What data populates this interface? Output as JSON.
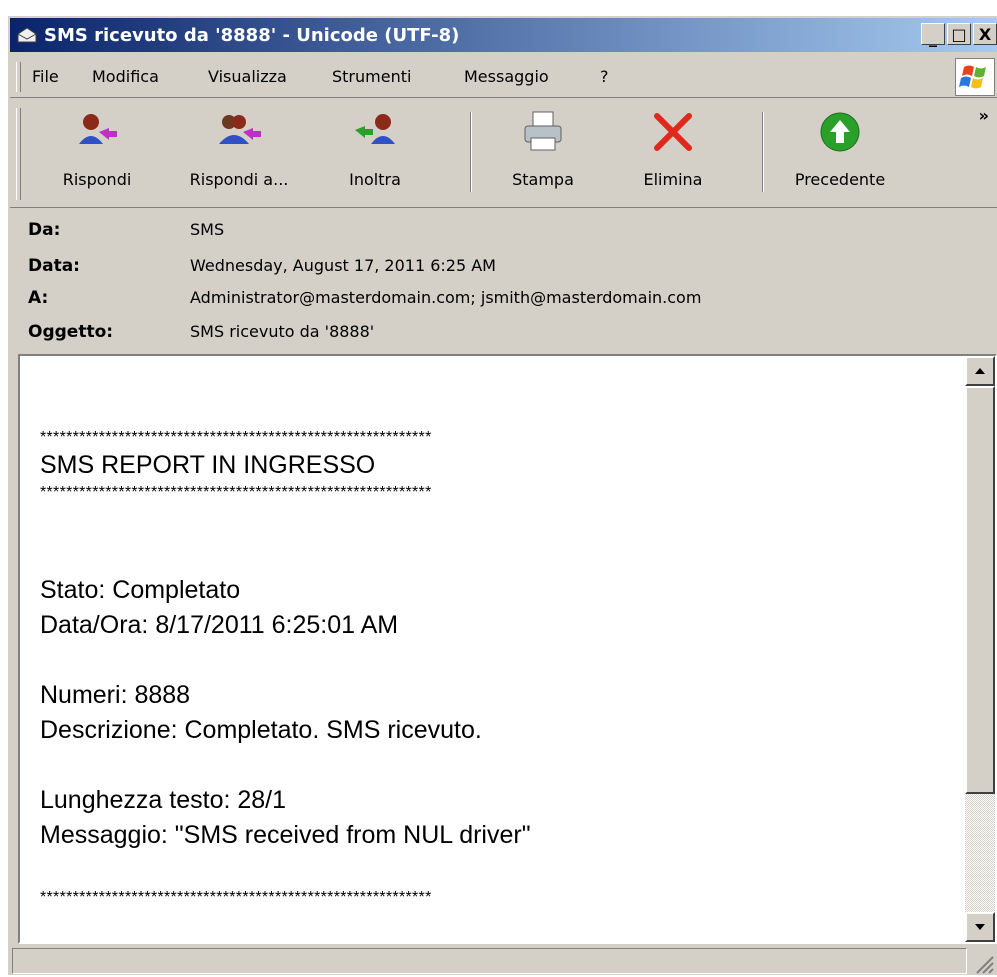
{
  "window": {
    "title": "SMS ricevuto da '8888' - Unicode (UTF-8)",
    "buttons": {
      "minimize": "_",
      "maximize": "□",
      "close": "X"
    }
  },
  "menu": {
    "items": [
      {
        "label": "File",
        "key": "F"
      },
      {
        "label": "Modifica",
        "key": "M"
      },
      {
        "label": "Visualizza",
        "key": "V"
      },
      {
        "label": "Strumenti",
        "key": "S"
      },
      {
        "label": "Messaggio",
        "key": "e"
      },
      {
        "label": "?",
        "key": "?"
      }
    ]
  },
  "toolbar": {
    "reply": "Rispondi",
    "reply_all": "Rispondi a...",
    "forward": "Inoltra",
    "print": "Stampa",
    "delete": "Elimina",
    "previous": "Precedente",
    "more": "»"
  },
  "header": {
    "from_label": "Da:",
    "from": "SMS",
    "date_label": "Data:",
    "date": "Wednesday, August 17, 2011 6:25 AM",
    "to_label": "A:",
    "to": "Administrator@masterdomain.com; jsmith@masterdomain.com",
    "subject_label": "Oggetto:",
    "subject": "SMS ricevuto da '8888'"
  },
  "message": {
    "stars": "************************************************************",
    "title": "SMS REPORT IN INGRESSO",
    "stato": "Stato: Completato",
    "data_ora": "Data/Ora: 8/17/2011 6:25:01 AM",
    "numeri": "Numeri: 8888",
    "descrizione": "Descrizione: Completato. SMS ricevuto.",
    "lunghezza": "Lunghezza testo: 28/1",
    "messaggio": "Messaggio: \"SMS received from NUL driver\""
  },
  "icons": {
    "window": "envelope-icon",
    "reply": "reply-icon",
    "reply_all": "reply-all-icon",
    "forward": "forward-icon",
    "print": "printer-icon",
    "delete": "delete-x-icon",
    "previous": "up-arrow-icon"
  },
  "colors": {
    "title_start": "#0a246a",
    "title_end": "#a6caf0",
    "chrome": "#d4d0c8",
    "delete_red": "#e0281c",
    "previous_green": "#2aa02a"
  }
}
